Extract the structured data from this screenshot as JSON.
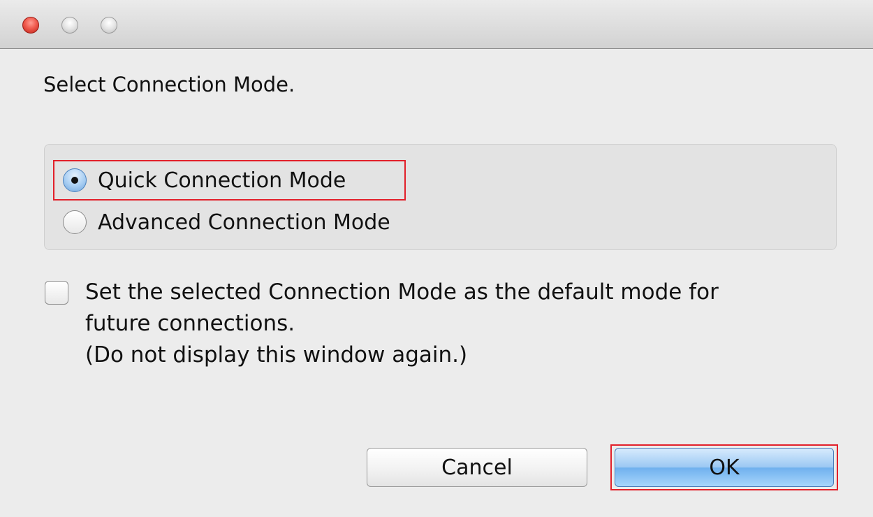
{
  "dialog": {
    "prompt": "Select Connection Mode."
  },
  "connection_modes": {
    "options": [
      {
        "label": "Quick Connection Mode",
        "selected": true
      },
      {
        "label": "Advanced Connection Mode",
        "selected": false
      }
    ]
  },
  "default_checkbox": {
    "checked": false,
    "lines": [
      "Set the selected Connection Mode as the default mode for",
      "future connections.",
      "(Do not display this window again.)"
    ]
  },
  "buttons": {
    "cancel_label": "Cancel",
    "ok_label": "OK"
  },
  "colors": {
    "highlight": "#e2202a",
    "default_button": "#6fb0ee",
    "close_button": "#f05b4e"
  }
}
